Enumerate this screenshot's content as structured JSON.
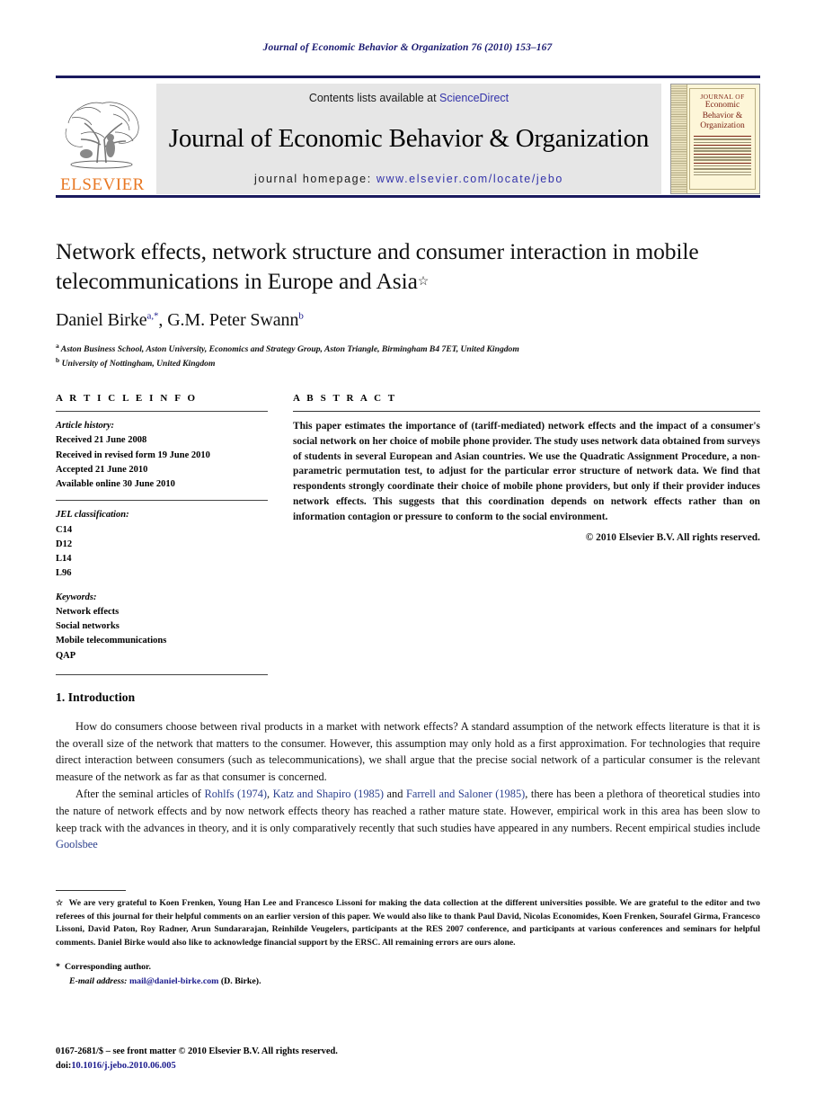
{
  "running_head": "Journal of Economic Behavior & Organization 76 (2010) 153–167",
  "masthead": {
    "publisher_name": "ELSEVIER",
    "contents_prefix": "Contents lists available at ",
    "contents_link": "ScienceDirect",
    "journal_title": "Journal of Economic Behavior & Organization",
    "homepage_prefix": "journal homepage: ",
    "homepage_url": "www.elsevier.com/locate/jebo",
    "cover": {
      "line1": "JOURNAL OF",
      "line2": "Economic",
      "line3": "Behavior &",
      "line4": "Organization"
    },
    "accent_rule_color": "#1a1a5e",
    "link_color": "#3333aa",
    "elsevier_orange": "#E87722"
  },
  "article": {
    "title": "Network effects, network structure and consumer interaction in mobile telecommunications in Europe and Asia",
    "title_footnote_mark": "☆",
    "authors": "Daniel Birke",
    "author1_sup": "a,*",
    "author2": ", G.M. Peter Swann",
    "author2_sup": "b",
    "affiliations": [
      {
        "mark": "a",
        "text": "Aston Business School, Aston University, Economics and Strategy Group, Aston Triangle, Birmingham B4 7ET, United Kingdom"
      },
      {
        "mark": "b",
        "text": "University of Nottingham, United Kingdom"
      }
    ]
  },
  "article_info": {
    "heading": "A R T I C L E   I N F O",
    "history_label": "Article history:",
    "history": [
      "Received 21 June 2008",
      "Received in revised form 19 June 2010",
      "Accepted 21 June 2010",
      "Available online 30 June 2010"
    ],
    "jel_label": "JEL classification:",
    "jel_codes": [
      "C14",
      "D12",
      "L14",
      "L96"
    ],
    "keywords_label": "Keywords:",
    "keywords": [
      "Network effects",
      "Social networks",
      "Mobile telecommunications",
      "QAP"
    ]
  },
  "abstract": {
    "heading": "A B S T R A C T",
    "text": "This paper estimates the importance of (tariff-mediated) network effects and the impact of a consumer's social network on her choice of mobile phone provider. The study uses network data obtained from surveys of students in several European and Asian countries. We use the Quadratic Assignment Procedure, a non-parametric permutation test, to adjust for the particular error structure of network data. We find that respondents strongly coordinate their choice of mobile phone providers, but only if their provider induces network effects. This suggests that this coordination depends on network effects rather than on information contagion or pressure to conform to the social environment.",
    "copyright": "© 2010 Elsevier B.V. All rights reserved."
  },
  "body": {
    "section_heading": "1.  Introduction",
    "paragraph1": "How do consumers choose between rival products in a market with network effects? A standard assumption of the network effects literature is that it is the overall size of the network that matters to the consumer. However, this assumption may only hold as a first approximation. For technologies that require direct interaction between consumers (such as telecommunications), we shall argue that the precise social network of a particular consumer is the relevant measure of the network as far as that consumer is concerned.",
    "p2_a": "After the seminal articles of ",
    "p2_cite1": "Rohlfs (1974)",
    "p2_b": ", ",
    "p2_cite2": "Katz and Shapiro (1985)",
    "p2_c": " and ",
    "p2_cite3": "Farrell and Saloner (1985)",
    "p2_d": ", there has been a plethora of theoretical studies into the nature of network effects and by now network effects theory has reached a rather mature state. However, empirical work in this area has been slow to keep track with the advances in theory, and it is only comparatively recently that such studies have appeared in any numbers. Recent empirical studies include ",
    "p2_cite4": "Goolsbee",
    "citation_color": "#2b3f8c"
  },
  "footnotes": {
    "star_mark": "☆",
    "acknowledgement": "We are very grateful to Koen Frenken, Young Han Lee and Francesco Lissoni for making the data collection at the different universities possible. We are grateful to the editor and two referees of this journal for their helpful comments on an earlier version of this paper. We would also like to thank Paul David, Nicolas Economides, Koen Frenken, Sourafel Girma, Francesco Lissoni, David Paton, Roy Radner, Arun Sundararajan, Reinhilde Veugelers, participants at the RES 2007 conference, and participants at various conferences and seminars for helpful comments. Daniel Birke would also like to acknowledge financial support by the ERSC. All remaining errors are ours alone.",
    "corresponding_mark": "*",
    "corresponding_label": "Corresponding author.",
    "email_label": "E-mail address:",
    "email": "mail@daniel-birke.com",
    "email_suffix": "(D. Birke)."
  },
  "imprint": {
    "line1": "0167-2681/$ – see front matter © 2010 Elsevier B.V. All rights reserved.",
    "doi_label": "doi:",
    "doi": "10.1016/j.jebo.2010.06.005"
  }
}
